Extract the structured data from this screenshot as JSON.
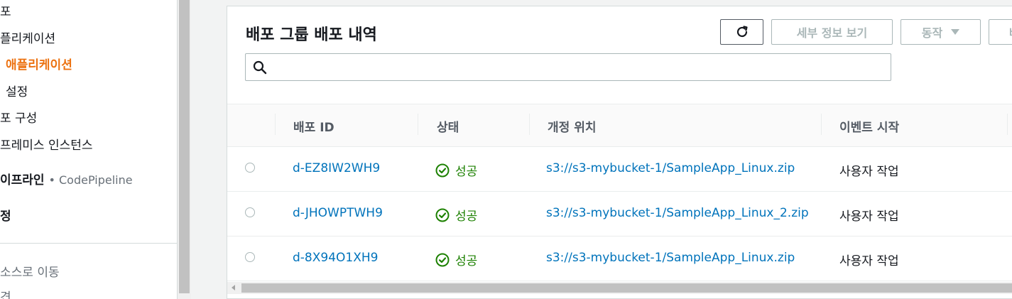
{
  "sidebar": {
    "items": [
      {
        "label": "포",
        "style": "normal"
      },
      {
        "label": "플리케이션",
        "style": "normal"
      },
      {
        "label": "애플리케이션",
        "style": "active"
      },
      {
        "label": "설정",
        "style": "normal"
      },
      {
        "label": "포 구성",
        "style": "normal"
      },
      {
        "label": "프레미스 인스턴스",
        "style": "normal"
      },
      {
        "label": "이프라인",
        "sub": "• CodePipeline",
        "style": "bold"
      },
      {
        "label": "정",
        "style": "bold"
      },
      {
        "label": "소스로 이동",
        "style": "muted"
      },
      {
        "label": "견",
        "style": "muted"
      }
    ]
  },
  "panel": {
    "title": "배포 그룹 배포 내역",
    "buttons": {
      "refresh_icon": "refresh-icon",
      "details": "세부 정보 보기",
      "actions": "동작",
      "more": "배"
    },
    "search": {
      "placeholder": "",
      "icon": "search-icon"
    }
  },
  "table": {
    "headers": [
      "배포 ID",
      "상태",
      "개정 위치",
      "이벤트 시작"
    ],
    "rows": [
      {
        "id": "d-EZ8IW2WH9",
        "status": "성공",
        "location": "s3://s3-mybucket-1/SampleApp_Linux.zip",
        "event": "사용자 작업"
      },
      {
        "id": "d-JHOWPTWH9",
        "status": "성공",
        "location": "s3://s3-mybucket-1/SampleApp_Linux_2.zip",
        "event": "사용자 작업"
      },
      {
        "id": "d-8X94O1XH9",
        "status": "성공",
        "location": "s3://s3-mybucket-1/SampleApp_Linux.zip",
        "event": "사용자 작업"
      }
    ]
  },
  "colors": {
    "accent": "#ec7211",
    "link": "#0073bb",
    "success": "#1d8102"
  }
}
